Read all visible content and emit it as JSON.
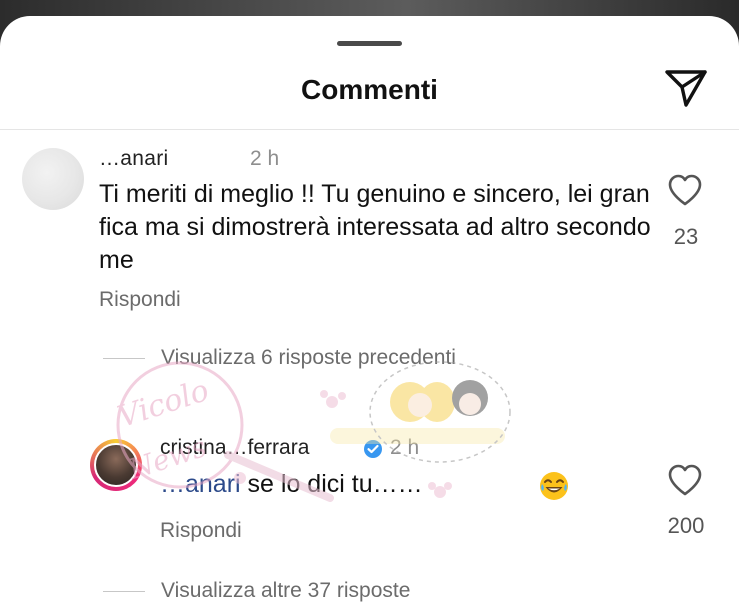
{
  "header": {
    "title": "Commenti",
    "share_icon": "paper-plane-icon"
  },
  "comments": [
    {
      "username": "…anari",
      "time": "2 h",
      "text": "Ti meriti di meglio !! Tu genuino e sincero, lei gran fica ma si dimostrerà interessata ad altro secondo me",
      "likes": "23",
      "reply_label": "Rispondi",
      "view_replies_label": "Visualizza 6 risposte precedenti"
    }
  ],
  "reply": {
    "username": "cristina…ferrara",
    "time": "2 h",
    "verified": true,
    "mention": "…anari",
    "text": " se lo dici tu……",
    "emoji": "😂",
    "likes": "200",
    "reply_label": "Rispondi"
  },
  "footer": {
    "view_more_label": "Visualizza altre 37 risposte"
  },
  "colors": {
    "verified": "#3897f0",
    "mention": "#2c4a8a",
    "secondary_text": "#6b6b6b",
    "story_ring": "#ee2a7b"
  },
  "watermark": {
    "text": "Vicolo delle News"
  }
}
